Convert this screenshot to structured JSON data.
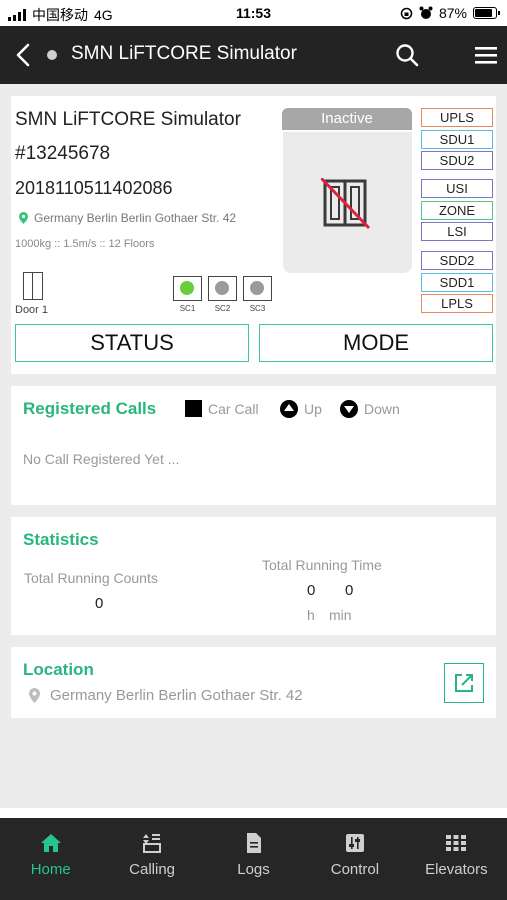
{
  "status_bar": {
    "carrier": "中国移动",
    "network": "4G",
    "time": "11:53",
    "battery": "87%",
    "battery_level": 0.87
  },
  "header": {
    "title": "SMN LiFTCORE Simulator",
    "back_icon": "chevron-left-icon",
    "search_icon": "search-icon",
    "menu_icon": "hamburger-icon"
  },
  "device": {
    "name": "SMN LiFTCORE Simulator",
    "id": "#13245678",
    "serial": "2018110511402086",
    "address": "Germany Berlin Berlin Gothaer Str. 42",
    "specs": "1000kg :: 1.5m/s :: 12 Floors",
    "door_label": "Door 1",
    "safety_circuits": [
      {
        "label": "SC1",
        "state": "on",
        "color": "#6ccc3b"
      },
      {
        "label": "SC2",
        "state": "off",
        "color": "#9a9a9a"
      },
      {
        "label": "SC3",
        "state": "off",
        "color": "#9a9a9a"
      }
    ],
    "state": "Inactive",
    "sensors": [
      {
        "label": "UPLS",
        "color": "#e8885c"
      },
      {
        "label": "SDU1",
        "color": "#56c1de"
      },
      {
        "label": "SDU2",
        "color": "#8b6fbe"
      },
      {
        "label": "USI",
        "color": "#7b74c7"
      },
      {
        "label": "ZONE",
        "color": "#52c48e"
      },
      {
        "label": "LSI",
        "color": "#7b74c7"
      },
      {
        "label": "SDD2",
        "color": "#8b6fbe"
      },
      {
        "label": "SDD1",
        "color": "#56c1de"
      },
      {
        "label": "LPLS",
        "color": "#e8885c"
      }
    ],
    "status_button": "STATUS",
    "mode_button": "MODE"
  },
  "registered_calls": {
    "title": "Registered Calls",
    "legend_car_call": "Car Call",
    "legend_up": "Up",
    "legend_down": "Down",
    "empty_text": "No Call Registered Yet ..."
  },
  "statistics": {
    "title": "Statistics",
    "running_counts_label": "Total Running Counts",
    "running_counts_value": "0",
    "running_time_label": "Total Running Time",
    "hours_value": "0",
    "minutes_value": "0",
    "hours_unit": "h",
    "minutes_unit": "min"
  },
  "location": {
    "title": "Location",
    "address": "Germany Berlin Berlin Gothaer Str. 42",
    "open_icon": "external-link-icon"
  },
  "tabs": [
    {
      "label": "Home",
      "icon": "home-icon",
      "active": true
    },
    {
      "label": "Calling",
      "icon": "calling-icon",
      "active": false
    },
    {
      "label": "Logs",
      "icon": "document-icon",
      "active": false
    },
    {
      "label": "Control",
      "icon": "sliders-icon",
      "active": false
    },
    {
      "label": "Elevators",
      "icon": "grid-icon",
      "active": false
    }
  ],
  "colors": {
    "accent": "#28b67e",
    "header_bg": "#232323",
    "tabbar_bg": "#262626"
  }
}
